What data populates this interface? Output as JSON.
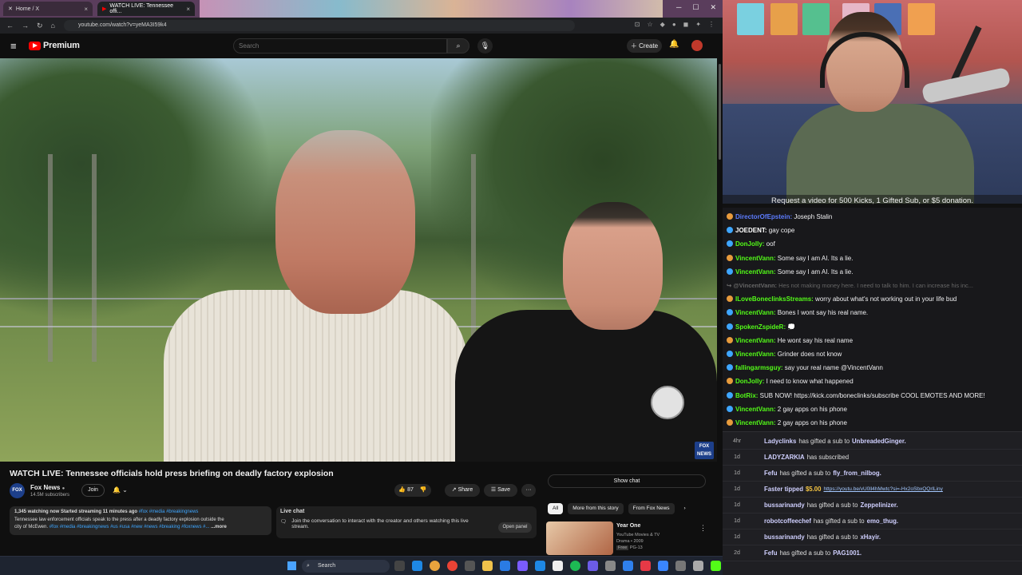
{
  "browser": {
    "tabs": [
      {
        "label": "Home / X"
      },
      {
        "label": "WATCH LIVE: Tennessee offi..."
      }
    ],
    "url": "youtube.com/watch?v=yeMA3I59k4"
  },
  "youtube": {
    "brand": "Premium",
    "search_placeholder": "Search",
    "create_label": "Create",
    "video": {
      "title": "WATCH LIVE: Tennessee officials hold press briefing on deadly factory explosion",
      "bug": "FOX NEWS"
    },
    "channel": {
      "avatar_text": "FOX",
      "name": "Fox News",
      "subscribers": "14.5M subscribers",
      "join_label": "Join"
    },
    "actions": {
      "likes": "87",
      "share_label": "Share",
      "save_label": "Save",
      "more_label": "···"
    },
    "show_chat_label": "Show chat",
    "description": {
      "line1_stats": "1,345 watching now  Started streaming 11 minutes ago",
      "line1_tags": "#fox #media #breakingnews",
      "line2": "Tennessee law enforcement officials speak to the press after a deadly factory explosion  outside the",
      "line3_text": "city of McEwen.",
      "line3_tags": "#fox #media #breakingnews #us #usa #new #news #breaking #foxnews #...",
      "more_label": "...more"
    },
    "live_chat": {
      "title": "Live chat",
      "text": "Join the conversation to interact with the creator and others watching this live stream.",
      "open_panel_label": "Open panel"
    },
    "chips": [
      "All",
      "More from this story",
      "From Fox News"
    ],
    "recommendation": {
      "title": "Year One",
      "channel": "YouTube Movies & TV",
      "meta": "Drama • 2009",
      "badge": "Free",
      "rating": "PG-13"
    }
  },
  "taskbar": {
    "search_label": "Search"
  },
  "stream": {
    "banner": "Request a video for 500 Kicks, 1 Gifted Sub, or $5 donation."
  },
  "chat": {
    "messages": [
      {
        "user": "DirectorOfEpstein:",
        "text": "Joseph Stalin",
        "color": "#5c7cff"
      },
      {
        "user": "JOEDENT:",
        "text": "gay cope",
        "color": "#ffffff"
      },
      {
        "user": "DonJolly:",
        "text": "oof",
        "color": "#53fc18"
      },
      {
        "user": "VincentVann:",
        "text": "Some say I am AI. Its a lie.",
        "color": "#53fc18"
      },
      {
        "user": "VincentVann:",
        "text": "Some say I am AI. Its a lie.",
        "color": "#53fc18"
      },
      {
        "user": "↪ @VincentVann:",
        "text": "Hes not making money here. I need to talk to him. I can increase his inc...",
        "color": "#666666"
      },
      {
        "user": "ILoveBonecIinksStreams:",
        "text": "worry about what's not working out in your life bud",
        "color": "#53fc18"
      },
      {
        "user": "VincentVann:",
        "text": "Bones I wont say his real name.",
        "color": "#53fc18"
      },
      {
        "user": "SpokenZspideR:",
        "text": "💭",
        "color": "#53fc18"
      },
      {
        "user": "VincentVann:",
        "text": "He wont say his real name",
        "color": "#53fc18"
      },
      {
        "user": "VincentVann:",
        "text": "Grinder does not know",
        "color": "#53fc18"
      },
      {
        "user": "fallingarmsguy:",
        "text": "say your real name @VincentVann",
        "color": "#53fc18"
      },
      {
        "user": "DonJolly:",
        "text": "I need to know what happened",
        "color": "#53fc18"
      },
      {
        "user": "BotRix:",
        "text": "SUB NOW! https://kick.com/boneclinks/subscribe COOL EMOTES AND MORE!",
        "color": "#53fc18"
      },
      {
        "user": "VincentVann:",
        "text": "2 gay apps on his phone",
        "color": "#53fc18"
      },
      {
        "user": "VincentVann:",
        "text": "2 gay apps on his phone",
        "color": "#53fc18"
      }
    ]
  },
  "events": [
    {
      "time": "4hr",
      "user": "Ladyclinks",
      "text": "has gifted a sub to",
      "target": "UnbreadedGinger."
    },
    {
      "time": "1d",
      "user": "LADYZARKIA",
      "text": "has subscribed",
      "target": ""
    },
    {
      "time": "1d",
      "user": "Fefu",
      "text": "has gifted a sub to",
      "target": "fly_from_nilbog."
    },
    {
      "time": "1d",
      "user": "Faster tipped",
      "text": "$5.00",
      "target": "https://youtu.be/vU0ll4hMwtc?si=-Hx2oSbxQQrlLiny"
    },
    {
      "time": "1d",
      "user": "bussarinandy",
      "text": "has gifted a sub to",
      "target": "Zeppelinizer."
    },
    {
      "time": "1d",
      "user": "robotcoffeechef",
      "text": "has gifted a sub to",
      "target": "emo_thug."
    },
    {
      "time": "1d",
      "user": "bussarinandy",
      "text": "has gifted a sub to",
      "target": "xHayir."
    },
    {
      "time": "2d",
      "user": "Fefu",
      "text": "has gifted a sub to",
      "target": "PAG1001."
    }
  ]
}
